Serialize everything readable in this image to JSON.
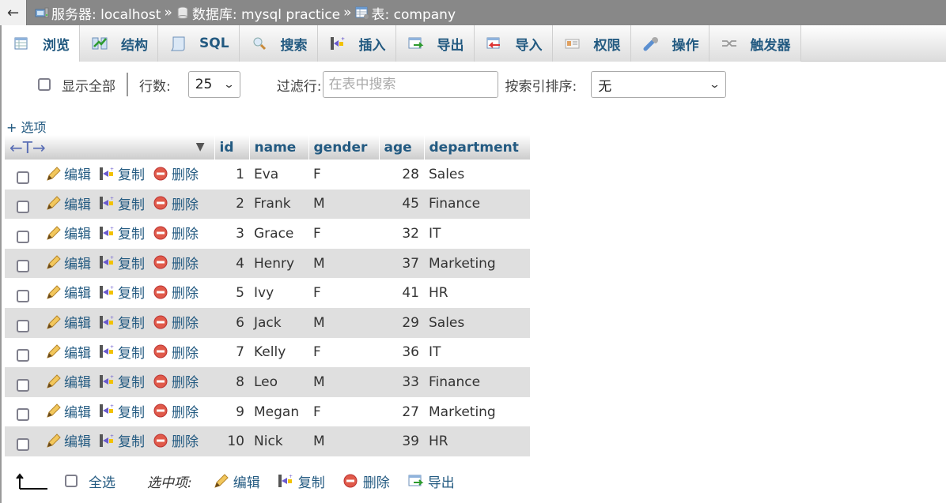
{
  "breadcrumb": {
    "back_glyph": "←",
    "items": [
      {
        "label": "服务器: localhost",
        "icon": "server-icon"
      },
      {
        "label": "数据库: mysql practice",
        "icon": "database-icon"
      },
      {
        "label": "表: company",
        "icon": "table-icon"
      }
    ],
    "separator": "»"
  },
  "tabs": [
    {
      "label": "浏览",
      "icon": "browse-icon",
      "active": true
    },
    {
      "label": "结构",
      "icon": "structure-icon"
    },
    {
      "label": "SQL",
      "icon": "sql-icon"
    },
    {
      "label": "搜索",
      "icon": "search-icon"
    },
    {
      "label": "插入",
      "icon": "insert-icon"
    },
    {
      "label": "导出",
      "icon": "export-icon"
    },
    {
      "label": "导入",
      "icon": "import-icon"
    },
    {
      "label": "权限",
      "icon": "privileges-icon"
    },
    {
      "label": "操作",
      "icon": "operations-icon"
    },
    {
      "label": "触发器",
      "icon": "triggers-icon"
    }
  ],
  "toolbar": {
    "show_all_label": "显示全部",
    "rows_label": "行数:",
    "rows_value": "25",
    "filter_label": "过滤行:",
    "filter_placeholder": "在表中搜索",
    "sort_label": "按索引排序:",
    "sort_value": "无"
  },
  "options_link": "+ 选项",
  "table": {
    "resize_glyph": "←T→",
    "columns": [
      "id",
      "name",
      "gender",
      "age",
      "department"
    ],
    "actions": {
      "edit": "编辑",
      "copy": "复制",
      "delete": "删除"
    },
    "rows": [
      {
        "id": "1",
        "name": "Eva",
        "gender": "F",
        "age": "28",
        "department": "Sales"
      },
      {
        "id": "2",
        "name": "Frank",
        "gender": "M",
        "age": "45",
        "department": "Finance"
      },
      {
        "id": "3",
        "name": "Grace",
        "gender": "F",
        "age": "32",
        "department": "IT"
      },
      {
        "id": "4",
        "name": "Henry",
        "gender": "M",
        "age": "37",
        "department": "Marketing"
      },
      {
        "id": "5",
        "name": "Ivy",
        "gender": "F",
        "age": "41",
        "department": "HR"
      },
      {
        "id": "6",
        "name": "Jack",
        "gender": "M",
        "age": "29",
        "department": "Sales"
      },
      {
        "id": "7",
        "name": "Kelly",
        "gender": "F",
        "age": "36",
        "department": "IT"
      },
      {
        "id": "8",
        "name": "Leo",
        "gender": "M",
        "age": "33",
        "department": "Finance"
      },
      {
        "id": "9",
        "name": "Megan",
        "gender": "F",
        "age": "27",
        "department": "Marketing"
      },
      {
        "id": "10",
        "name": "Nick",
        "gender": "M",
        "age": "39",
        "department": "HR"
      }
    ]
  },
  "bottom": {
    "select_all": "全选",
    "with_selected": "选中项:",
    "edit": "编辑",
    "copy": "复制",
    "delete": "删除",
    "export": "导出"
  },
  "colors": {
    "link": "#235a81",
    "topbar": "#888888",
    "row_even": "#dfdfdf"
  }
}
